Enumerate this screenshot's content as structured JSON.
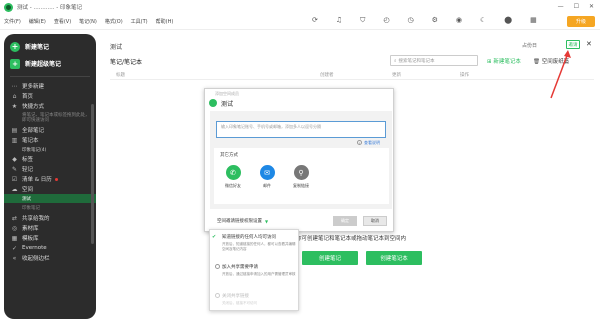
{
  "window": {
    "title": "测试 - ............ - 印象笔记"
  },
  "menu": [
    "文件(F)",
    "编辑(E)",
    "查看(V)",
    "笔记(N)",
    "格式(O)",
    "工具(T)",
    "帮助(H)"
  ],
  "toolbar": {
    "upgrade_label": "升级"
  },
  "sidebar": {
    "new_note": "新建笔记",
    "new_super_note": "新建超级笔记",
    "items": [
      {
        "icon": "⋯",
        "label": "更多新建"
      },
      {
        "icon": "⌂",
        "label": "首页"
      },
      {
        "icon": "★",
        "label": "快捷方式"
      }
    ],
    "shortcut_hint": "将笔记、笔记本或标签拖到此处，即可快速访问",
    "items2": [
      {
        "icon": "▤",
        "label": "全部笔记"
      },
      {
        "icon": "▥",
        "label": "笔记本"
      }
    ],
    "nb_sub": "印象笔记(4)",
    "items3": [
      {
        "icon": "◆",
        "label": "标签"
      },
      {
        "icon": "✎",
        "label": "轻记"
      },
      {
        "icon": "☑",
        "label": "清单 & 日历"
      },
      {
        "icon": "☁",
        "label": "空间"
      }
    ],
    "space_active": "测试",
    "space_sub": "印象笔记",
    "items4": [
      {
        "icon": "⇄",
        "label": "共享给我的"
      },
      {
        "icon": "◎",
        "label": "素材库"
      },
      {
        "icon": "▦",
        "label": "模板库"
      },
      {
        "icon": "✓",
        "label": "Evernote"
      },
      {
        "icon": "«",
        "label": "收起侧边栏"
      }
    ]
  },
  "main": {
    "title": "测试",
    "occupy": "占份日",
    "share_button": "邀请",
    "notebooks_header": "笔记/笔记本",
    "search_placeholder": "搜索笔记和笔记本",
    "new_notebook": "新建笔记本",
    "trash": "空间废纸篓",
    "columns": [
      "标题",
      "创建者",
      "更新",
      "操作"
    ],
    "hint": "你可创建笔记和笔记本或拖动笔记本到空间内",
    "create_note_btn": "创建笔记",
    "create_notebook_btn": "创建笔记本"
  },
  "dialog": {
    "caption": "添加空间成员",
    "name": "测试",
    "input_placeholder": "输入印象笔记账号、手机号或邮箱，添加多人以逗号分隔",
    "permission_link": "查看说明",
    "other_methods": "其它方式",
    "share_options": [
      {
        "label": "微信好友",
        "icon": "wechat-icon",
        "color": "#2dbe60",
        "glyph": "✆"
      },
      {
        "label": "邮件",
        "icon": "mail-icon",
        "color": "#1e88e5",
        "glyph": "✉"
      },
      {
        "label": "复制链接",
        "icon": "link-icon",
        "color": "#777777",
        "glyph": "⚲"
      }
    ],
    "permission_select": "空间邀请链接权限设置",
    "ok": "确定",
    "cancel": "取消"
  },
  "dropdown": {
    "opt1": "知道链接的任何人均可访问",
    "opt1_desc": "开放后，知道链接的任何人，都可以查看并编辑空间及笔记内容",
    "opt2": "加入共享需要申请",
    "opt2_desc": "开放后，通过链接申请加入的用户需管理员审核",
    "opt3": "关闭共享链接",
    "opt3_desc": "关闭后，链接不可访问"
  }
}
